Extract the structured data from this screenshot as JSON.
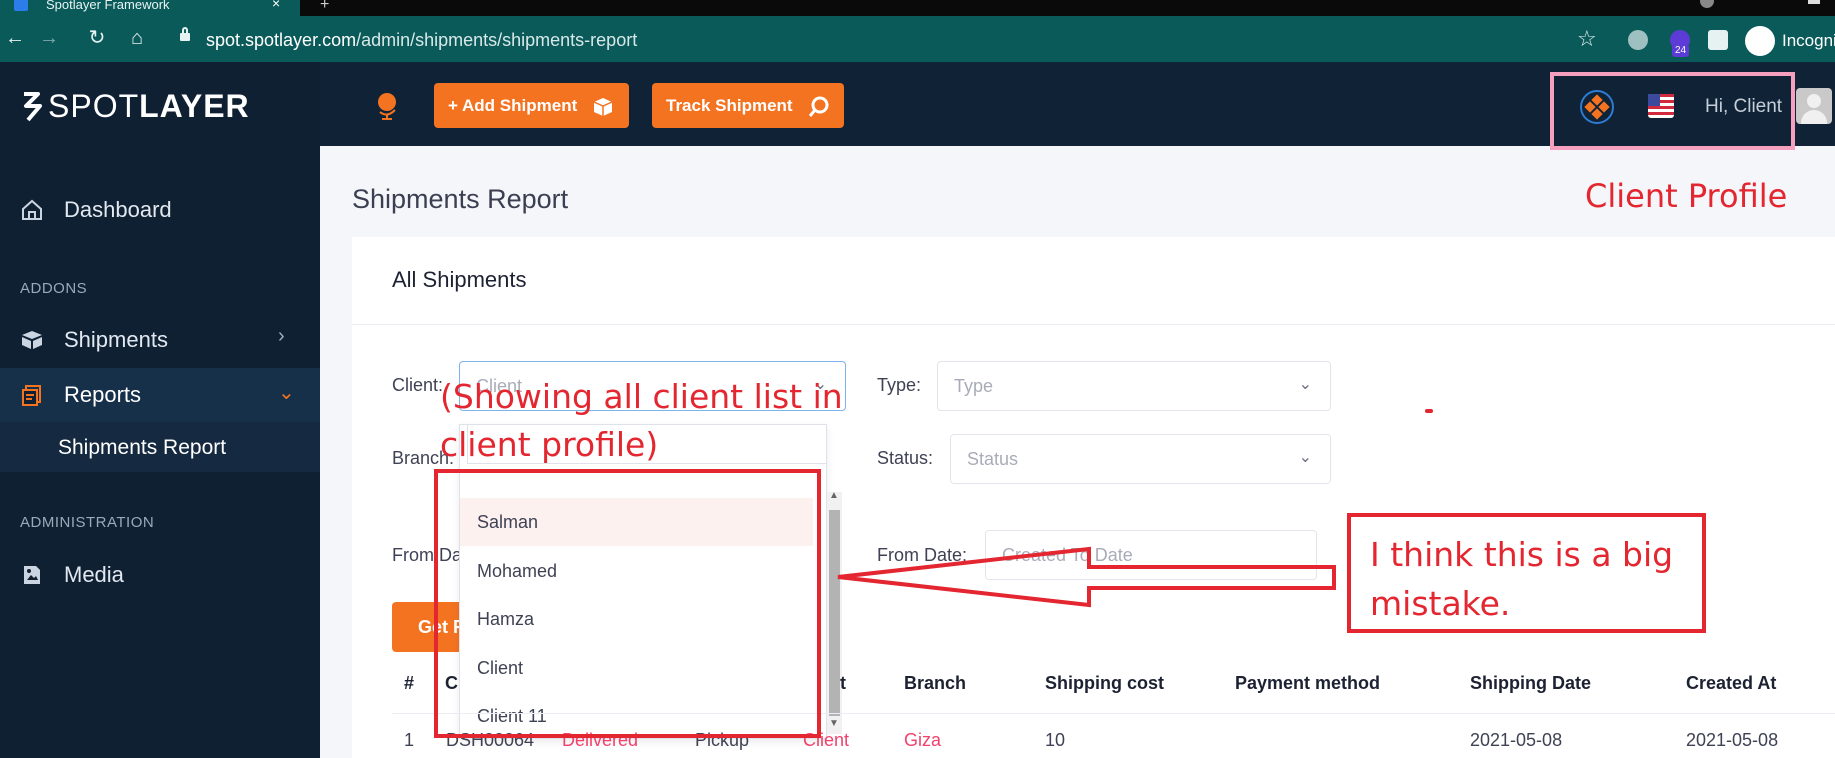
{
  "browser": {
    "tab_title": "Spotlayer Framework",
    "new_tab": "+",
    "url_domain": "spot.spotlayer.com",
    "url_path": "/admin/shipments/shipments-report",
    "extension_badge": "24",
    "incognito_label": "Incognito"
  },
  "sidebar": {
    "logo_light": "SPOT",
    "logo_bold": "LAYER",
    "dashboard": "Dashboard",
    "section_addons": "ADDONS",
    "shipments": "Shipments",
    "reports": "Reports",
    "shipments_report": "Shipments Report",
    "section_administration": "ADMINISTRATION",
    "media": "Media"
  },
  "header": {
    "add_shipment": "+ Add Shipment",
    "track_shipment": "Track Shipment",
    "greeting": "Hi, Client"
  },
  "page": {
    "title": "Shipments Report",
    "card_title": "All Shipments"
  },
  "filters": {
    "client_label": "Client:",
    "client_placeholder": "Client",
    "type_label": "Type:",
    "type_placeholder": "Type",
    "branch_label": "Branch:",
    "status_label": "Status:",
    "status_placeholder": "Status",
    "from_date_left_label": "From Da",
    "from_date_label": "From Date:",
    "from_date_placeholder": "Created To Date",
    "get_button": "Get R"
  },
  "client_dropdown": {
    "options": [
      "Salman",
      "Mohamed",
      "Hamza",
      "Client",
      "Client 11"
    ]
  },
  "table": {
    "headers": [
      "#",
      "C",
      "t",
      "Branch",
      "Shipping cost",
      "Payment method",
      "Shipping Date",
      "Created At"
    ],
    "row": {
      "num": "1",
      "code": "DSH00064",
      "status": "Delivered",
      "type": "Pickup",
      "client": "Client",
      "branch": "Giza",
      "shipping_cost": "10",
      "payment_method": "",
      "shipping_date": "2021-05-08",
      "created_at": "2021-05-08"
    }
  },
  "annotations": {
    "profile_label": "Client Profile",
    "dropdown_note_line1": "(Showing all client list in",
    "dropdown_note_line2": "client profile)",
    "mistake_line1": "I think this is a big",
    "mistake_line2": "mistake."
  },
  "colors": {
    "accent": "#f47321",
    "sidebar_bg": "#102033",
    "header_bg": "#0f2236",
    "annotation_red": "#e3262f",
    "annotation_pink": "#f6a0c0",
    "chrome_teal": "#0b5a5a"
  }
}
